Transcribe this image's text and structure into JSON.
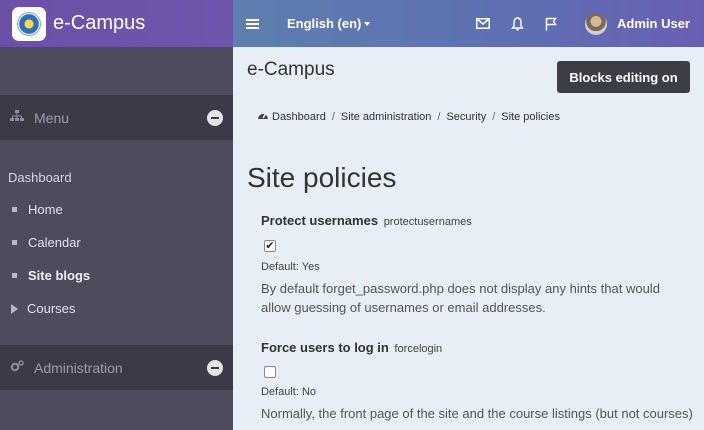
{
  "brand": {
    "name": "e-Campus"
  },
  "topbar": {
    "language": "English (en)",
    "user_name": "Admin User"
  },
  "sidebar": {
    "menu_title": "Menu",
    "nav_heading": "Dashboard",
    "items": [
      {
        "label": "Home"
      },
      {
        "label": "Calendar"
      },
      {
        "label": "Site blogs"
      },
      {
        "label": "Courses"
      }
    ],
    "admin_title": "Administration"
  },
  "main": {
    "header_title": "e-Campus",
    "blocks_button": "Blocks editing on",
    "breadcrumb": [
      "Dashboard",
      "Site administration",
      "Security",
      "Site policies"
    ],
    "heading": "Site policies",
    "settings": [
      {
        "title": "Protect usernames",
        "key": "protectusernames",
        "checked": true,
        "default": "Default: Yes",
        "description": "By default forget_password.php does not display any hints that would allow guessing of usernames or email addresses."
      },
      {
        "title": "Force users to log in",
        "key": "forcelogin",
        "checked": false,
        "default": "Default: No",
        "description": "Normally, the front page of the site and the course listings (but not courses)"
      }
    ]
  }
}
